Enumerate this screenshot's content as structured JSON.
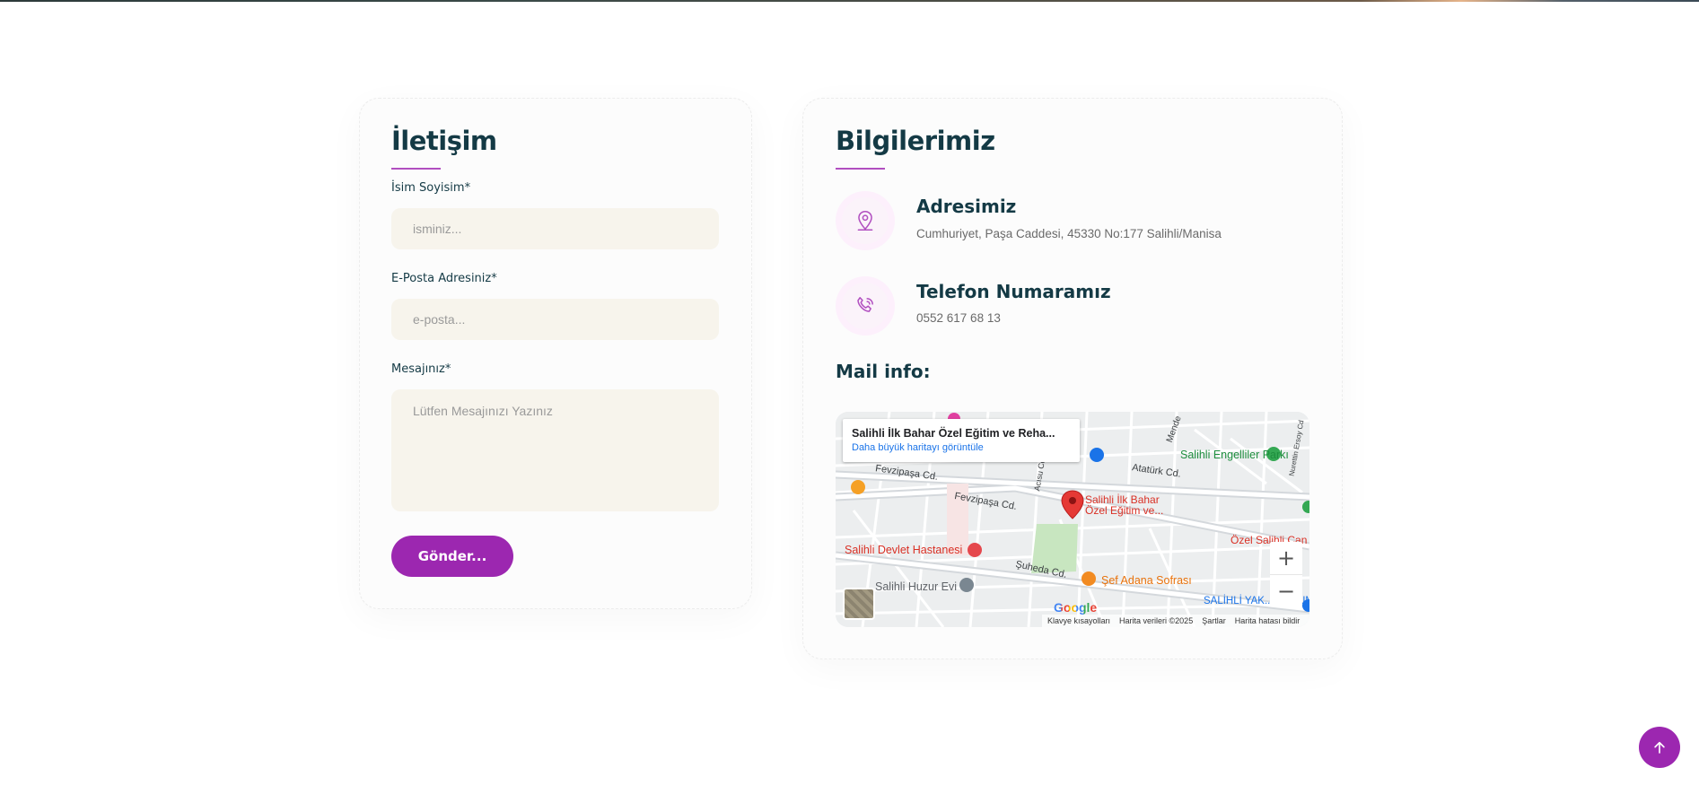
{
  "contact": {
    "title": "İletişim",
    "name_label": "İsim Soyisim*",
    "name_placeholder": "isminiz...",
    "email_label": "E-Posta Adresiniz*",
    "email_placeholder": "e-posta...",
    "message_label": "Mesajınız*",
    "message_placeholder": "Lütfen Mesajınızı Yazınız",
    "submit_label": "Gönder..."
  },
  "info": {
    "title": "Bilgilerimiz",
    "address_title": "Adresimiz",
    "address_text": "Cumhuriyet, Paşa Caddesi, 45330 No:177 Salihli/Manisa",
    "phone_title": "Telefon Numaramız",
    "phone_text": "0552 617 68 13",
    "mail_title": "Mail info:"
  },
  "map": {
    "place_title": "Salihli İlk Bahar Özel Eğitim ve Reha...",
    "larger_map_link": "Daha büyük haritayı görüntüle",
    "marker_label_1": "Salihli İlk Bahar",
    "marker_label_2": "Özel Eğitim ve...",
    "poi_park": "Salihli Engelliler Parkı",
    "poi_hospital": "Salihli Devlet Hastanesi",
    "poi_huzur": "Salihli Huzur Evi",
    "poi_restaurant": "Şef Adana Sofrası",
    "poi_ozel": "Özel Salihli Can",
    "poi_kurum": "SALİHLİ YAK... KURUMES",
    "street_ataturk": "Atatürk Cd.",
    "street_fevzipasa_1": "Fevzipaşa Cd.",
    "street_fevzipasa_2": "Fevzipaşa Cd.",
    "street_suheda": "Şuheda Cd.",
    "street_acarsu": "Acısu Cd.",
    "street_mende": "Mende",
    "street_nurettin": "Nurettin Ersoy Cd",
    "zoom_in": "+",
    "zoom_out": "−",
    "google": "Google",
    "footer_shortcuts": "Klavye kısayolları",
    "footer_data": "Harita verileri ©2025",
    "footer_terms": "Şartlar",
    "footer_report": "Harita hatası bildir"
  },
  "colors": {
    "accent": "#9c27b0",
    "heading": "#143a45",
    "field_bg": "#f7f4ec"
  }
}
